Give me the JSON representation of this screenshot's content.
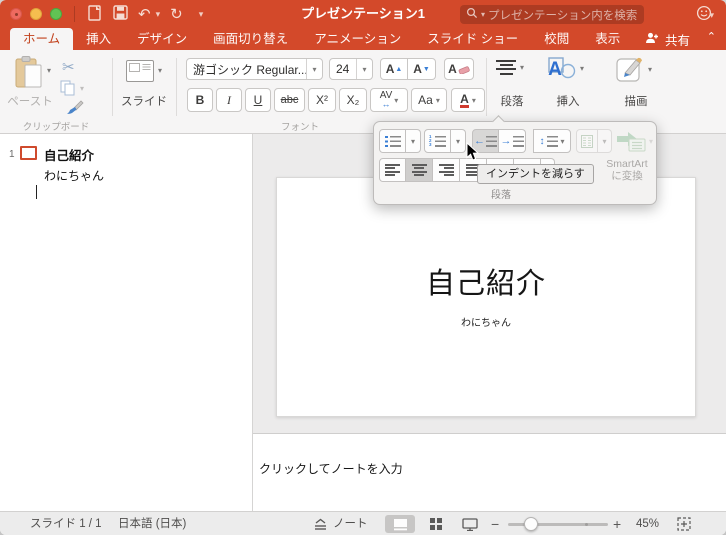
{
  "titlebar": {
    "title": "プレゼンテーション1",
    "search_placeholder": "プレゼンテーション内を検索"
  },
  "tabs": [
    {
      "label": "ホーム",
      "active": true
    },
    {
      "label": "挿入",
      "active": false
    },
    {
      "label": "デザイン",
      "active": false
    },
    {
      "label": "画面切り替え",
      "active": false
    },
    {
      "label": "アニメーション",
      "active": false
    },
    {
      "label": "スライド ショー",
      "active": false
    },
    {
      "label": "校閲",
      "active": false
    },
    {
      "label": "表示",
      "active": false
    }
  ],
  "share": {
    "label": "共有"
  },
  "ribbon": {
    "paste": {
      "label": "ペースト"
    },
    "clipboard_group_label": "クリップボード",
    "slides": {
      "label": "スライド"
    },
    "font": {
      "name": "游ゴシック Regular...",
      "size": "24",
      "group_label": "フォント",
      "grow_label": "A",
      "shrink_label": "A",
      "clear_label": "A",
      "bold": "B",
      "italic": "I",
      "underline": "U",
      "strikethrough": "abc",
      "superscript": "X²",
      "subscript": "X₂",
      "spacing": "AV",
      "case": "Aa",
      "color": "A"
    },
    "paragraph": {
      "label": "段落"
    },
    "insert": {
      "label": "挿入"
    },
    "draw": {
      "label": "描画"
    }
  },
  "paragraph_popup": {
    "tooltip": "インデントを減らす",
    "group_label": "段落",
    "smartart_line1": "SmartArt",
    "smartart_line2": "に変換"
  },
  "outline": {
    "slide_number": "1",
    "title": "自己紹介",
    "body": "わにちゃん"
  },
  "slide": {
    "title": "自己紹介",
    "subtitle": "わにちゃん"
  },
  "notes": {
    "placeholder": "クリックしてノートを入力"
  },
  "statusbar": {
    "slide_counter": "スライド 1 / 1",
    "language": "日本語 (日本)",
    "notes_label": "ノート",
    "zoom_out": "−",
    "zoom_in": "+",
    "zoom_level": "45%"
  },
  "colors": {
    "accent_red": "#d3492a",
    "tab_active_text": "#c2421d",
    "icon_blue": "#3a7fd5",
    "outline_slide_border": "#cf4a2d",
    "font_color_bar": "#d03b2f"
  }
}
